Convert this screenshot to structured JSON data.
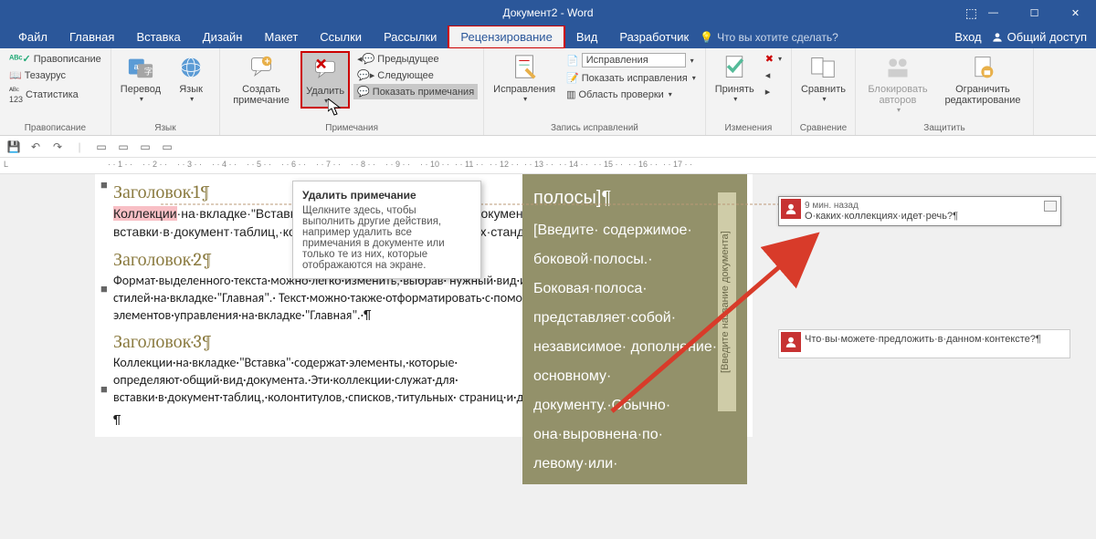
{
  "titlebar": {
    "title": "Документ2 - Word"
  },
  "menubar": {
    "tabs": [
      "Файл",
      "Главная",
      "Вставка",
      "Дизайн",
      "Макет",
      "Ссылки",
      "Рассылки",
      "Рецензирование",
      "Вид",
      "Разработчик"
    ],
    "active_index": 7,
    "tell_me": "Что вы хотите сделать?",
    "sign_in": "Вход",
    "share": "Общий доступ"
  },
  "ribbon": {
    "groups": {
      "proofing": {
        "label": "Правописание",
        "items": [
          "Правописание",
          "Тезаурус",
          "Статистика"
        ]
      },
      "language": {
        "label": "Язык",
        "translate": "Перевод",
        "lang": "Язык"
      },
      "comments": {
        "label": "Примечания",
        "new": "Создать примечание",
        "delete": "Удалить",
        "previous": "Предыдущее",
        "next": "Следующее",
        "show": "Показать примечания"
      },
      "tracking": {
        "label": "Запись исправлений",
        "track": "Исправления",
        "display_mode": "Исправления",
        "show_markup": "Показать исправления",
        "reviewing_pane": "Область проверки"
      },
      "changes": {
        "label": "Изменения",
        "accept": "Принять"
      },
      "compare": {
        "label": "Сравнение",
        "compare": "Сравнить"
      },
      "protect": {
        "label": "Защитить",
        "block": "Блокировать авторов",
        "restrict": "Ограничить редактирование"
      }
    }
  },
  "tooltip": {
    "title": "Удалить примечание",
    "body": "Щелкните здесь, чтобы выполнить другие действия, например удалить все примечания в документе или только те из них, которые отображаются на экране."
  },
  "document": {
    "headings": [
      "Заголовок·1¶",
      "Заголовок·2¶",
      "Заголовок·3¶"
    ],
    "p1_highlight": "Коллекции",
    "p1_rest": "·на·вкладке·\"Вставка\"·… определяют·общий·вид·документа … вставки·в·документ·таблиц,·колонтитулов … страниц·и·других·стандартных·блоков.¶",
    "p2": "Формат·выделенного·текста·можно·легко·изменить,·выбрав· нужный·вид·из·коллекции·экспресс-стилей·на·вкладке·\"Главная\".· Текст·можно·также·отформатировать·с·помощью·других· элементов·управления·на·вкладке·\"Главная\".·¶",
    "p3": "Коллекции·на·вкладке·\"Вставка\"·содержат·элементы,·которые· определяют·общий·вид·документа.·Эти·коллекции·служат·для· вставки·в·документ·таблиц,·колонтитулов,·списков,·титульных· страниц·и·других·стандартных·блоков.¶",
    "p4": "¶"
  },
  "sidebar": {
    "title": "полосы]¶",
    "body": "[Введите· содержимое· боковой·полосы.· Боковая·полоса· представляет·собой· независимое· дополнение·к· основному· документу.·Обычно· она·выровнена·по· левому·или·",
    "label": "[Введите название документа]"
  },
  "comments": [
    {
      "time": "9 мин. назад",
      "text": "О·каких·коллекциях·идет·речь?¶"
    },
    {
      "text": "Что·вы·можете·предложить·в·данном·контексте?¶"
    }
  ],
  "ruler_marks": [
    "1",
    "2",
    "3",
    "4",
    "5",
    "6",
    "7",
    "8",
    "9",
    "10",
    "11",
    "12",
    "13",
    "14",
    "15",
    "16",
    "17"
  ]
}
